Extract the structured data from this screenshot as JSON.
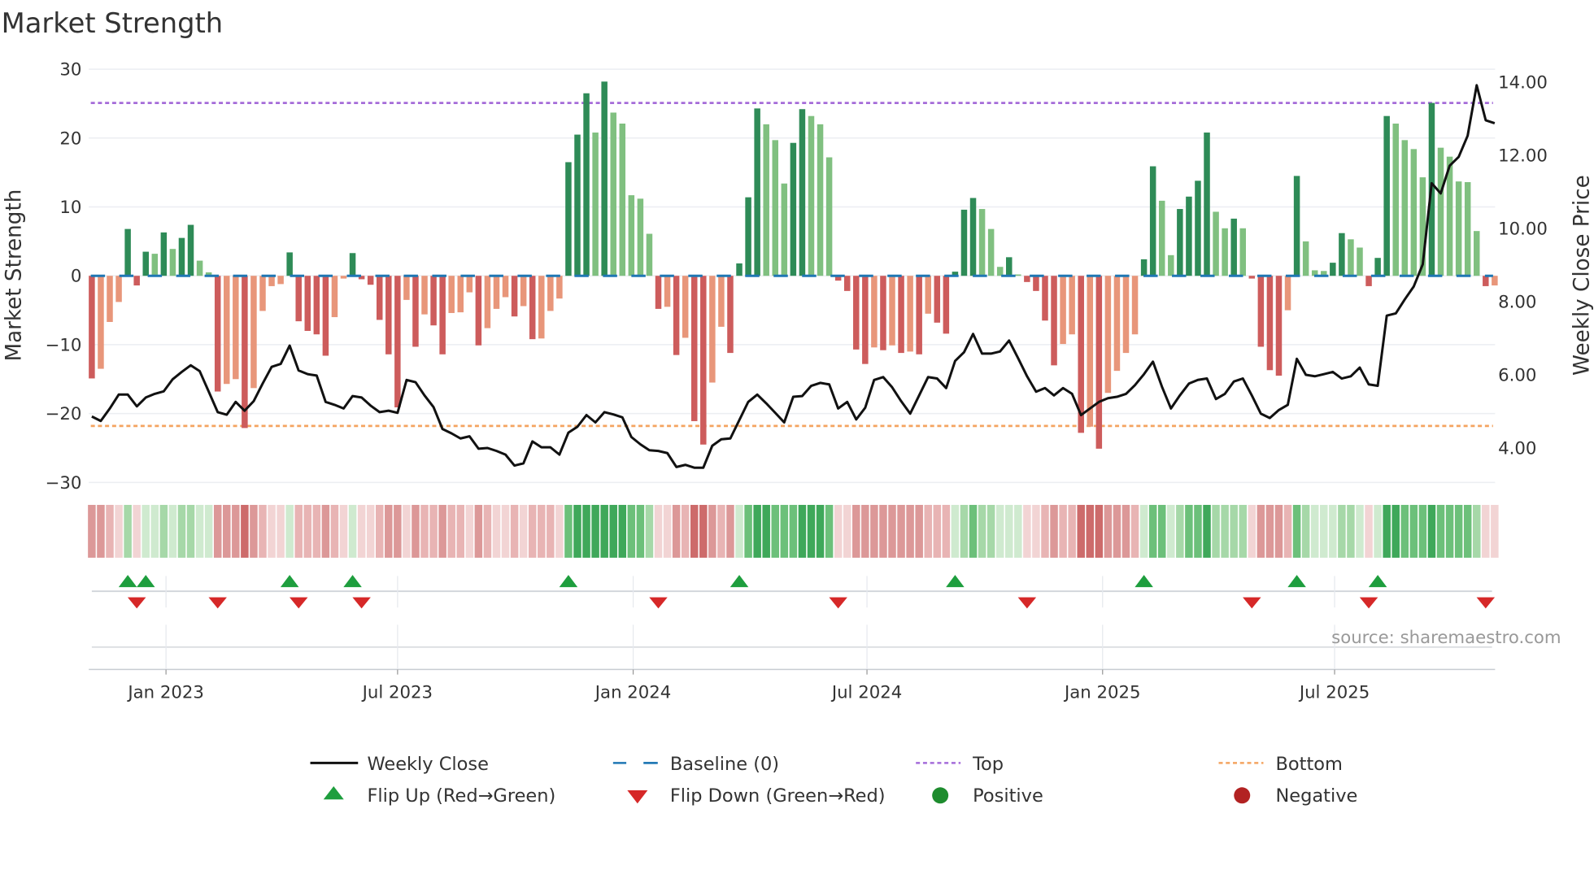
{
  "chart_data": {
    "type": "bar",
    "title": "Market Strength",
    "ylabel": "Market Strength",
    "y2label": "Weekly Close Price",
    "ylim": [
      -33,
      33
    ],
    "y_ticks": [
      30,
      20,
      10,
      0,
      -10,
      -20,
      -30
    ],
    "y_tick_labels": [
      "30",
      "20",
      "10",
      "0",
      "−10",
      "−20",
      "−30"
    ],
    "y2_ticks": [
      14,
      12,
      10,
      8,
      6,
      4
    ],
    "y2_tick_labels": [
      "14.00",
      "12.00",
      "10.00",
      "8.00",
      "6.00",
      "4.00"
    ],
    "x_ticks": [
      {
        "label": "Jan 2023",
        "week": 8.25
      },
      {
        "label": "Jul 2023",
        "week": 34.0
      },
      {
        "label": "Jan 2024",
        "week": 60.2
      },
      {
        "label": "Jul 2024",
        "week": 86.2
      },
      {
        "label": "Jan 2025",
        "week": 112.4
      },
      {
        "label": "Jul 2025",
        "week": 138.2
      }
    ],
    "top_level": 25.1,
    "bottom_level": -21.8,
    "baseline": 0,
    "strength": [
      -14.9,
      -13.5,
      -6.7,
      -3.8,
      6.8,
      -1.4,
      3.5,
      3.2,
      6.3,
      3.9,
      5.5,
      7.4,
      2.2,
      0.5,
      -16.8,
      -15.7,
      -15.0,
      -22.1,
      -16.3,
      -5.1,
      -1.5,
      -1.2,
      3.4,
      -6.6,
      -8.0,
      -8.5,
      -11.6,
      -6.0,
      -0.4,
      3.3,
      -0.5,
      -1.3,
      -6.4,
      -11.4,
      -19.1,
      -3.5,
      -10.3,
      -5.6,
      -7.2,
      -11.4,
      -5.4,
      -5.3,
      -2.4,
      -10.1,
      -7.6,
      -4.8,
      -3.1,
      -5.9,
      -4.4,
      -9.2,
      -9.1,
      -5.1,
      -3.3,
      16.5,
      20.5,
      26.5,
      20.8,
      28.2,
      23.7,
      22.1,
      11.7,
      11.2,
      6.1,
      -4.8,
      -4.5,
      -11.5,
      -9.0,
      -21.1,
      -24.5,
      -15.5,
      -7.4,
      -11.2,
      1.8,
      11.4,
      24.3,
      22.0,
      19.7,
      13.4,
      19.3,
      24.2,
      23.2,
      22.0,
      17.2,
      -0.7,
      -2.2,
      -10.7,
      -12.8,
      -10.4,
      -10.8,
      -10.1,
      -11.2,
      -11.0,
      -11.4,
      -5.5,
      -6.8,
      -8.4,
      0.6,
      9.6,
      11.3,
      9.7,
      6.8,
      1.3,
      2.7,
      0.2,
      -0.9,
      -2.2,
      -6.5,
      -13.0,
      -9.9,
      -8.5,
      -22.8,
      -21.9,
      -25.1,
      -17.0,
      -13.8,
      -11.2,
      -8.5,
      2.4,
      15.9,
      10.9,
      3.0,
      9.7,
      11.5,
      13.8,
      20.8,
      9.3,
      6.9,
      8.3,
      6.9,
      -0.4,
      -10.3,
      -13.7,
      -14.5,
      -5.0,
      14.5,
      5.0,
      0.8,
      0.7,
      1.9,
      6.2,
      5.3,
      4.1,
      -1.5,
      2.6,
      23.2,
      22.1,
      19.7,
      18.4,
      14.3,
      25.1,
      18.6,
      17.3,
      13.7,
      13.6,
      6.5,
      -1.5,
      -1.4
    ],
    "weekly_close": [
      4.86,
      4.74,
      5.08,
      5.46,
      5.46,
      5.14,
      5.38,
      5.48,
      5.55,
      5.88,
      6.08,
      6.26,
      6.1,
      5.54,
      4.98,
      4.91,
      5.26,
      5.02,
      5.28,
      5.76,
      6.22,
      6.3,
      6.8,
      6.12,
      6.02,
      5.98,
      5.26,
      5.18,
      5.08,
      5.42,
      5.38,
      5.16,
      4.98,
      5.02,
      4.96,
      5.86,
      5.8,
      5.44,
      5.12,
      4.52,
      4.4,
      4.26,
      4.32,
      3.98,
      4.0,
      3.92,
      3.82,
      3.52,
      3.58,
      4.18,
      4.02,
      4.02,
      3.82,
      4.42,
      4.58,
      4.9,
      4.7,
      4.98,
      4.92,
      4.84,
      4.3,
      4.1,
      3.94,
      3.92,
      3.86,
      3.48,
      3.54,
      3.46,
      3.46,
      4.06,
      4.24,
      4.26,
      4.76,
      5.26,
      5.46,
      5.22,
      4.96,
      4.7,
      5.4,
      5.42,
      5.7,
      5.78,
      5.74,
      5.08,
      5.26,
      4.78,
      5.1,
      5.86,
      5.94,
      5.66,
      5.28,
      4.94,
      5.44,
      5.94,
      5.9,
      5.64,
      6.38,
      6.62,
      7.12,
      6.58,
      6.58,
      6.64,
      6.94,
      6.46,
      5.96,
      5.54,
      5.64,
      5.44,
      5.64,
      5.48,
      4.9,
      5.08,
      5.26,
      5.36,
      5.4,
      5.48,
      5.72,
      6.02,
      6.36,
      5.68,
      5.08,
      5.44,
      5.76,
      5.86,
      5.9,
      5.34,
      5.48,
      5.82,
      5.9,
      5.44,
      4.94,
      4.82,
      5.04,
      5.18,
      6.44,
      6.0,
      5.96,
      6.02,
      6.08,
      5.9,
      5.96,
      6.2,
      5.74,
      5.7,
      7.62,
      7.68,
      8.06,
      8.42,
      9.02,
      11.24,
      10.96,
      11.72,
      11.96,
      12.54,
      13.92,
      12.96,
      12.88
    ],
    "legend": {
      "placement": "bottom",
      "items": [
        "Weekly Close",
        "Baseline (0)",
        "Top",
        "Bottom",
        "Flip Up (Red→Green)",
        "Flip Down (Green→Red)",
        "Positive",
        "Negative"
      ]
    },
    "colors": {
      "green_up": "#2e8b57",
      "green_down": "#80c080",
      "red_down": "#cd5c5c",
      "red_up": "#e8967a",
      "top": "#a56cd9",
      "bottom": "#f4a460",
      "baseline": "#1f77b4",
      "line": "#111111",
      "flip_up": "#1e9e3e",
      "flip_down": "#d62828",
      "positive": "#1e8c2e",
      "negative": "#b22222"
    },
    "source": "source: sharemaestro.com"
  }
}
